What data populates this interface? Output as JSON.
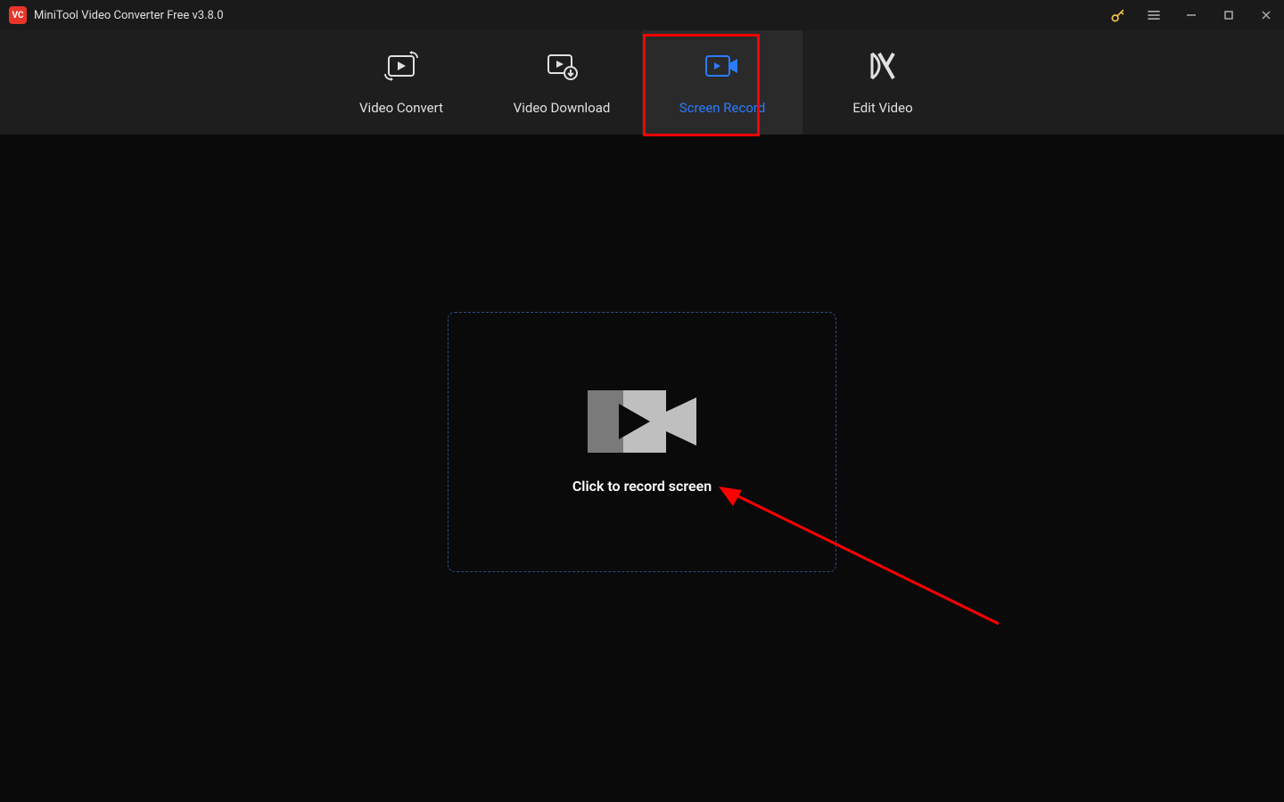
{
  "titlebar": {
    "app_icon_letters": "VC",
    "title": "MiniTool Video Converter Free v3.8.0"
  },
  "nav": {
    "tabs": [
      {
        "id": "video-convert",
        "label": "Video Convert",
        "active": false
      },
      {
        "id": "video-download",
        "label": "Video Download",
        "active": false
      },
      {
        "id": "screen-record",
        "label": "Screen Record",
        "active": true
      },
      {
        "id": "edit-video",
        "label": "Edit Video",
        "active": false
      }
    ]
  },
  "main": {
    "record_prompt": "Click to record screen"
  },
  "colors": {
    "accent_blue": "#2a7cff",
    "highlight_red": "#ff0000",
    "bg_dark": "#0a0a0a",
    "bg_panel": "#1e1e1e",
    "app_icon_bg": "#e73529",
    "key_gold": "#f5c542"
  },
  "annotations": {
    "red_box_around": "screen-record-tab",
    "red_arrow_points_to": "record-dropzone"
  }
}
